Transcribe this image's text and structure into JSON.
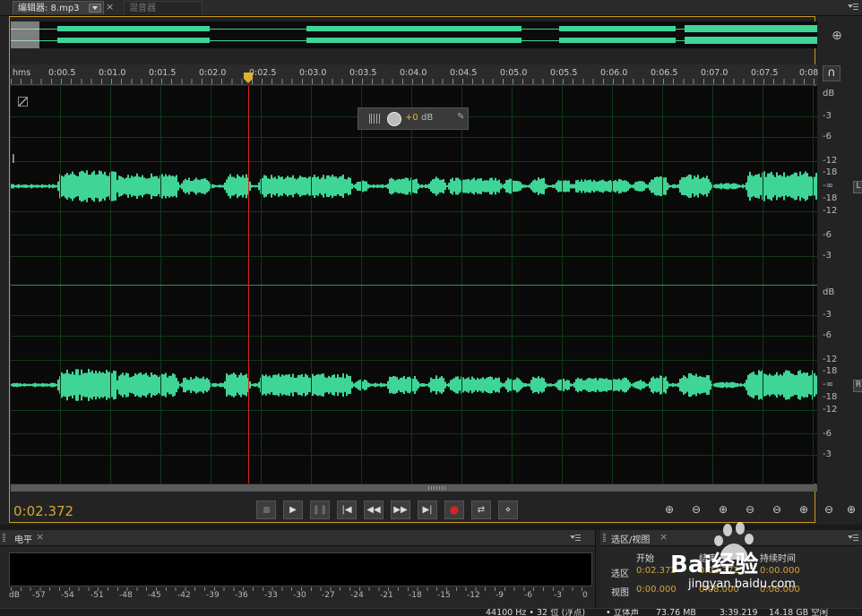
{
  "tabs": {
    "editor_label": "编辑器: 8.mp3",
    "close": "×",
    "mixer_label": "混音器"
  },
  "ruler": {
    "unit": "hms",
    "labels": [
      "0:00.5",
      "0:01.0",
      "0:01.5",
      "0:02.0",
      "0:02.5",
      "0:03.0",
      "0:03.5",
      "0:04.0",
      "0:04.5",
      "0:05.0",
      "0:05.5",
      "0:06.0",
      "0:06.5",
      "0:07.0",
      "0:07.5",
      "0:08"
    ]
  },
  "hud": {
    "value": "+0",
    "unit": "dB"
  },
  "db_scale": {
    "top_channel": [
      "dB",
      "-3",
      "-6",
      "-12",
      "-18",
      "-∞",
      "-18",
      "-12",
      "-6",
      "-3"
    ],
    "bottom_channel": [
      "dB",
      "-3",
      "-6",
      "-12",
      "-18",
      "-∞",
      "-18",
      "-12",
      "-6",
      "-3"
    ],
    "left_tag": "L",
    "right_tag": "R"
  },
  "transport": {
    "timecode": "0:02.372",
    "playhead_fraction": 0.2935
  },
  "levels_panel": {
    "title": "电平",
    "close": "×",
    "scale": [
      "dB",
      "-57",
      "-54",
      "-51",
      "-48",
      "-45",
      "-42",
      "-39",
      "-36",
      "-33",
      "-30",
      "-27",
      "-24",
      "-21",
      "-18",
      "-15",
      "-12",
      "-9",
      "-6",
      "-3",
      "0"
    ]
  },
  "selection_panel": {
    "title": "选区/视图",
    "close": "×",
    "col_start": "开始",
    "col_end": "结束",
    "col_duration": "持续时间",
    "row_selection": "选区",
    "row_view": "视图",
    "sel_start": "0:02.372",
    "sel_end": "0:02.372",
    "sel_duration": "0:00.000",
    "view_start": "0:00.000",
    "view_end": "0:08.000",
    "view_duration": "0:08.000"
  },
  "status": {
    "sample": "44100 Hz • 32 位 (浮点)",
    "type": "• 立体声",
    "size": "73.76 MB",
    "length": "3:39.219",
    "free": "14.18 GB 空闲"
  },
  "watermark": {
    "text": "Bai经验",
    "url": "jingyan.baidu.com"
  },
  "colors": {
    "waveform": "#3fd597",
    "accent": "#d9a536",
    "playhead": "#d22222",
    "background": "#0a0a0a"
  }
}
